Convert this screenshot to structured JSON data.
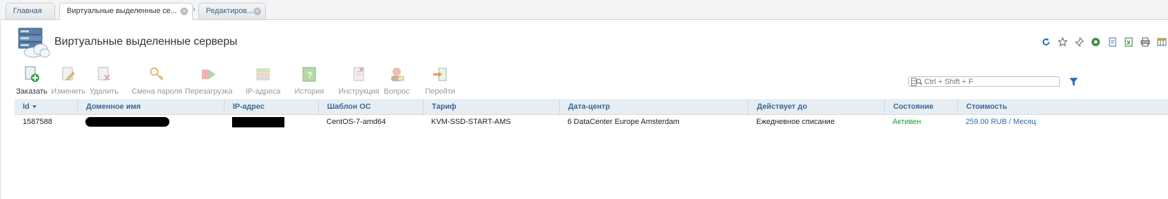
{
  "tabs": [
    {
      "label": "Главная",
      "active": false,
      "closable": false
    },
    {
      "label": "Виртуальные выделенные се...",
      "active": true,
      "closable": true
    },
    {
      "label": "Редактиров...",
      "active": false,
      "closable": true
    }
  ],
  "page": {
    "title": "Виртуальные выделенные серверы",
    "icon": "server-cloud-icon"
  },
  "util_icons": [
    "refresh-icon",
    "star-icon",
    "pin-icon",
    "settings-icon",
    "copy-icon",
    "excel-icon",
    "print-icon",
    "table-icon"
  ],
  "toolbar": {
    "order": "Заказать",
    "edit": "Изменить",
    "delete": "Удалить",
    "change_password": "Смена пароля",
    "reboot": "Перезагрузка",
    "ip_addresses": "IP-адреса",
    "history": "История",
    "instruction": "Инструкция",
    "question": "Вопрос",
    "go_to": "Перейти"
  },
  "search": {
    "placeholder": "Ctrl + Shift + F",
    "value": ""
  },
  "table": {
    "columns": {
      "id": "Id",
      "domain": "Доменное имя",
      "ip": "IP-адрес",
      "os_template": "Шаблон ОС",
      "tariff": "Тариф",
      "datacenter": "Дата-центр",
      "valid_until": "Действует до",
      "status": "Состояние",
      "cost": "Стоимость"
    },
    "rows": [
      {
        "id": "1587588",
        "domain": "",
        "ip": "",
        "os_template": "CentOS-7-amd64",
        "tariff": "KVM-SSD-START-AMS",
        "datacenter": "6 DataCenter Europe Amsterdam",
        "valid_until": "Ежедневное списание",
        "status": "Активен",
        "cost": "259.00 RUB / Месяц"
      }
    ]
  },
  "colors": {
    "link": "#2f6ba8",
    "header_text": "#3a6a96",
    "header_bg": "#e6edf3",
    "status_active": "#1f9a2e"
  }
}
